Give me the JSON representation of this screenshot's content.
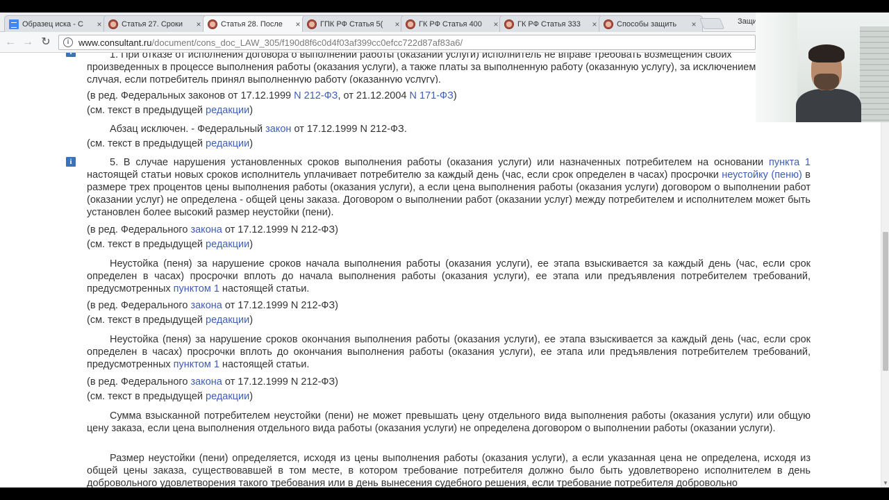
{
  "browser": {
    "tabs": [
      {
        "label": "Образец иска - C",
        "icon": "google-docs-icon",
        "active": false
      },
      {
        "label": "Статья 27. Сроки",
        "icon": "consultant-icon",
        "active": false
      },
      {
        "label": "Статья 28. После",
        "icon": "consultant-icon",
        "active": true
      },
      {
        "label": "ГПК РФ Статья 5(",
        "icon": "consultant-icon",
        "active": false
      },
      {
        "label": "ГК РФ Статья 400",
        "icon": "consultant-icon",
        "active": false
      },
      {
        "label": "ГК РФ Статья 333",
        "icon": "consultant-icon",
        "active": false
      },
      {
        "label": "Способы защить",
        "icon": "consultant-icon",
        "active": false
      }
    ],
    "tab_close": "×",
    "tab_overflow_label": "Защи",
    "nav": {
      "back": "←",
      "forward": "→",
      "reload": "↻"
    },
    "url_host": "www.consultant.ru",
    "url_path": "/document/cons_doc_LAW_305/f190d8f6c0d4f03af399cc0efcc722d87af83a6/"
  },
  "doc": {
    "p0": {
      "l0": "1. При отказе от исполнения договора о выполнении работы (оказании услуги) исполнитель не вправе требовать возмещения своих",
      "l1": "произведенных в процессе выполнения работы (оказания услуги), а также платы за выполненную работу (оказанную услугу), за исключением",
      "l2": "случая, если потребитель принял выполненную работу (оказанную услугу)."
    },
    "r1": {
      "pre": "(в ред. Федеральных законов от 17.12.1999 ",
      "link1": "N 212-ФЗ",
      "mid": ", от 21.12.2004 ",
      "link2": "N 171-ФЗ",
      "post": ")"
    },
    "see": {
      "pre": "(см. текст в предыдущей ",
      "link": "редакции",
      "post": ")"
    },
    "excl": {
      "pre": "Абзац исключен. - Федеральный ",
      "link": "закон",
      "post": " от 17.12.1999 N 212-ФЗ."
    },
    "info_icon": "i",
    "p5": {
      "t1": "5. В случае нарушения установленных сроков выполнения работы (оказания услуги) или назначенных потребителем на основании ",
      "l1": "пункта 1",
      "t2": " настоящей статьи новых сроков исполнитель уплачивает потребителю за каждый день (час, если срок определен в часах) просрочки ",
      "l2": "неустойку (пеню)",
      "t3": " в размере трех процентов цены выполнения работы (оказания услуги), а если цена выполнения работы (оказания услуги) договором о выполнении работ (оказании услуг) не определена - общей цены заказа. Договором о выполнении работ (оказании услуг) между потребителем и исполнителем может быть установлен более высокий размер неустойки (пени)."
    },
    "r2": {
      "pre": "(в ред. Федерального ",
      "link": "закона",
      "post": " от 17.12.1999 N 212-ФЗ)"
    },
    "p6": {
      "t1": "Неустойка (пеня) за нарушение сроков начала выполнения работы (оказания услуги), ее этапа взыскивается за каждый день (час, если срок определен в часах) просрочки вплоть до начала выполнения работы (оказания услуги), ее этапа или предъявления потребителем требований, предусмотренных ",
      "l1": "пунктом 1",
      "t2": " настоящей статьи."
    },
    "p7": {
      "t1": "Неустойка (пеня) за нарушение сроков окончания выполнения работы (оказания услуги), ее этапа взыскивается за каждый день (час, если срок определен в часах) просрочки вплоть до окончания выполнения работы (оказания услуги), ее этапа или предъявления потребителем требований, предусмотренных ",
      "l1": "пунктом 1",
      "t2": " настоящей статьи."
    },
    "p8": "Сумма взысканной потребителем неустойки (пени) не может превышать цену отдельного вида выполнения работы (оказания услуги) или общую цену заказа, если цена выполнения отдельного вида работы (оказания услуги) не определена договором о выполнении работы (оказании услуги).",
    "p9": "Размер неустойки (пени) определяется, исходя из цены выполнения работы (оказания услуги), а если указанная цена не определена, исходя из общей цены заказа, существовавшей в том месте, в котором требование потребителя должно было быть удовлетворено исполнителем в день добровольного удовлетворения такого требования или в день вынесения судебного решения, если требование потребителя добровольно"
  },
  "colors": {
    "link": "#3f5db5",
    "text": "#333333",
    "info_icon": "#3d72b8"
  }
}
